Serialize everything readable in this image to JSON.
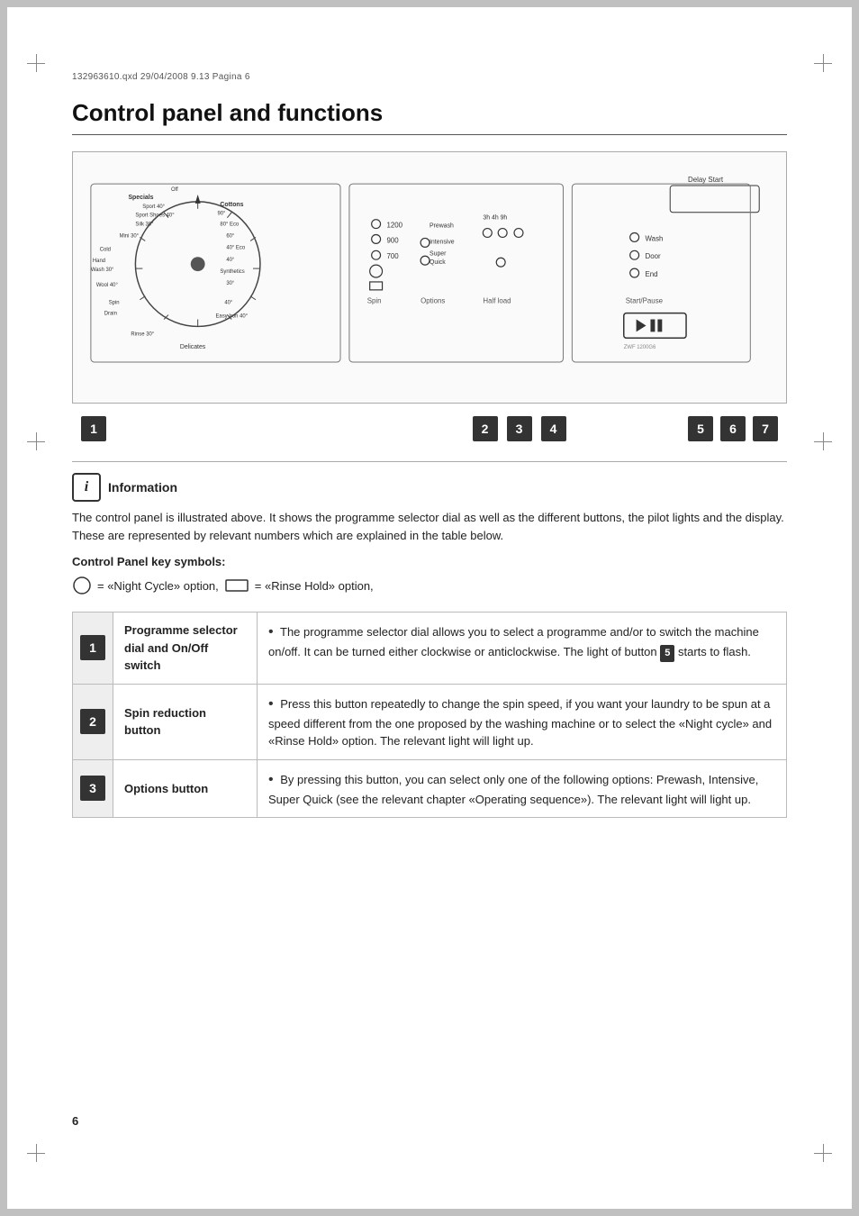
{
  "header": {
    "file_info": "132963610.qxd    29/04/2008    9.13    Pagina    6"
  },
  "page": {
    "title": "Control panel and functions",
    "page_number": "6"
  },
  "info_section": {
    "icon_label": "i",
    "title": "Information",
    "paragraph": "The control panel is illustrated above. It shows the programme selector dial as well as the different buttons, the pilot lights and the display. These are represented by relevant numbers which are explained in the table below.",
    "key_symbols_label": "Control Panel key symbols:",
    "symbol_description": " = «Night Cycle» option,    = «Rinse Hold» option,"
  },
  "diagram": {
    "labels": [
      {
        "num": "1",
        "x_pct": 22
      },
      {
        "num": "2",
        "x_pct": 50
      },
      {
        "num": "3",
        "x_pct": 58
      },
      {
        "num": "4",
        "x_pct": 67
      },
      {
        "num": "5",
        "x_pct": 80
      },
      {
        "num": "6",
        "x_pct": 87
      },
      {
        "num": "7",
        "x_pct": 94
      }
    ]
  },
  "table": {
    "rows": [
      {
        "number": "1",
        "label": "Programme selector dial and On/Off switch",
        "description": "The programme selector dial allows you to select a programme and/or to switch the machine on/off. It can be turned either clockwise or anticlockwise. The light of button 5 starts to flash.",
        "badge_num": "5"
      },
      {
        "number": "2",
        "label": "Spin reduction button",
        "description": "Press this button repeatedly to change the spin speed, if you want your laundry to be spun at a speed different from the one proposed by the washing machine or to select the «Night cycle» and «Rinse Hold» option. The relevant light will light up."
      },
      {
        "number": "3",
        "label": "Options button",
        "description": "By pressing this button, you can select only one of the following options: Prewash, Intensive, Super Quick (see the relevant chapter «Operating sequence»). The relevant light will light up."
      }
    ]
  }
}
